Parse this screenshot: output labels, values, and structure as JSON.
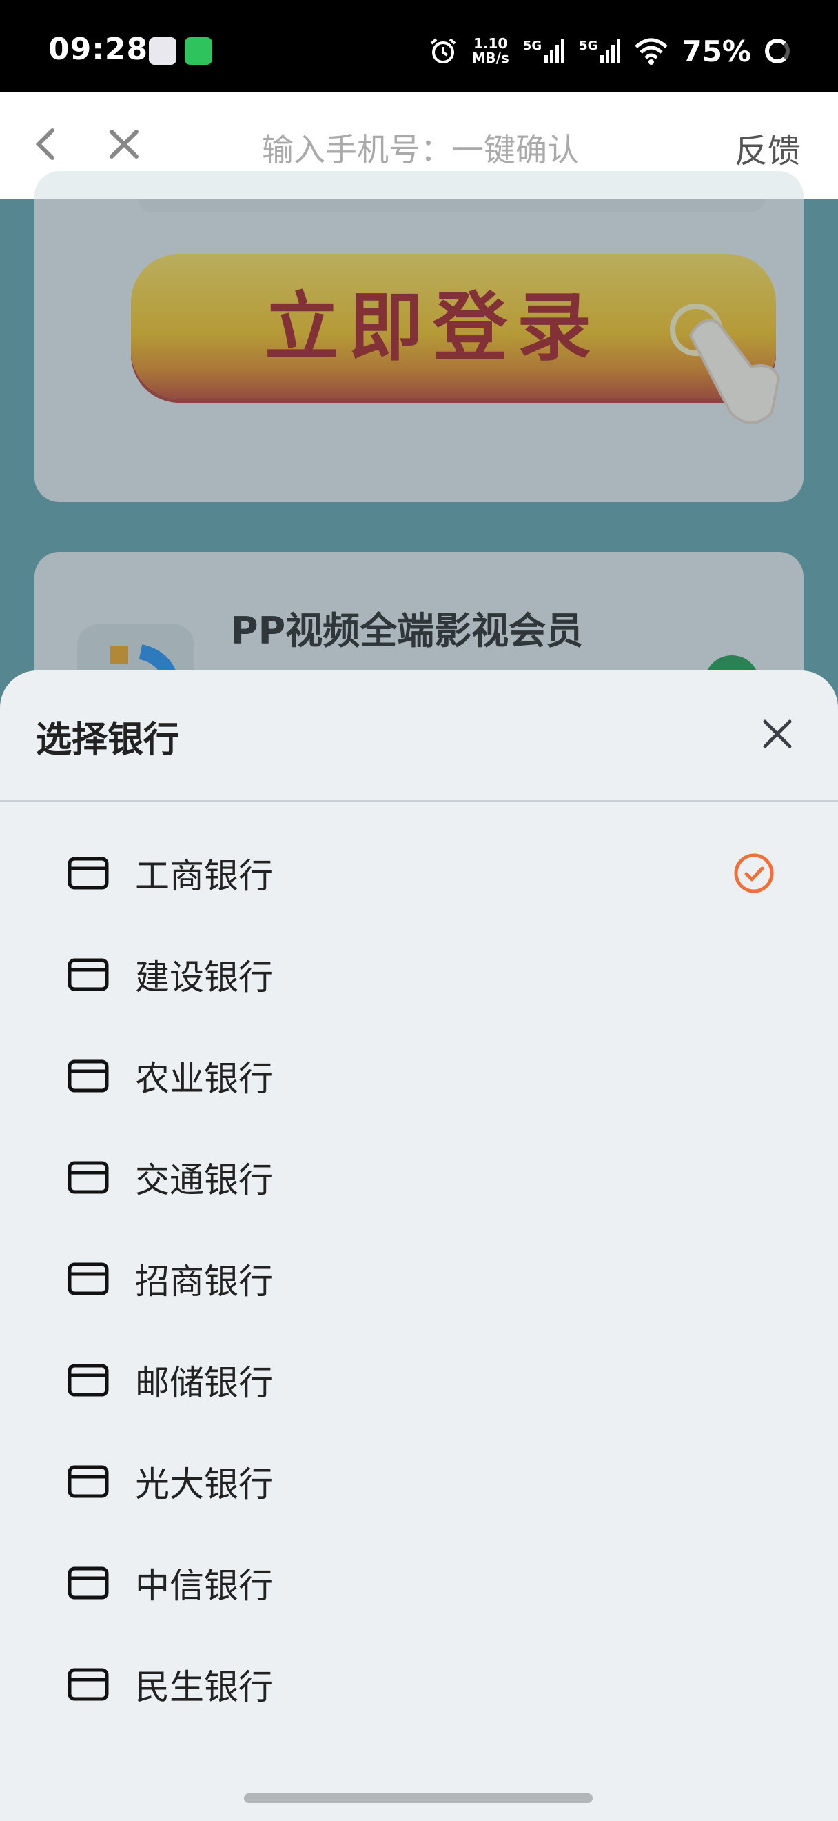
{
  "status_bar": {
    "time": "09:28",
    "net_speed_value": "1.10",
    "net_speed_unit": "MB/s",
    "signal1": "5G",
    "signal2": "5G",
    "battery": "75%"
  },
  "nav": {
    "title": "输入手机号：一键确认",
    "feedback": "反馈"
  },
  "background": {
    "login_button": "立即登录",
    "member_title": "PP视频全端影视会员"
  },
  "sheet": {
    "title": "选择银行",
    "selected_index": 0,
    "accent_color": "#f0703a",
    "banks": [
      {
        "label": "工商银行"
      },
      {
        "label": "建设银行"
      },
      {
        "label": "农业银行"
      },
      {
        "label": "交通银行"
      },
      {
        "label": "招商银行"
      },
      {
        "label": "邮储银行"
      },
      {
        "label": "光大银行"
      },
      {
        "label": "中信银行"
      },
      {
        "label": "民生银行"
      }
    ]
  }
}
